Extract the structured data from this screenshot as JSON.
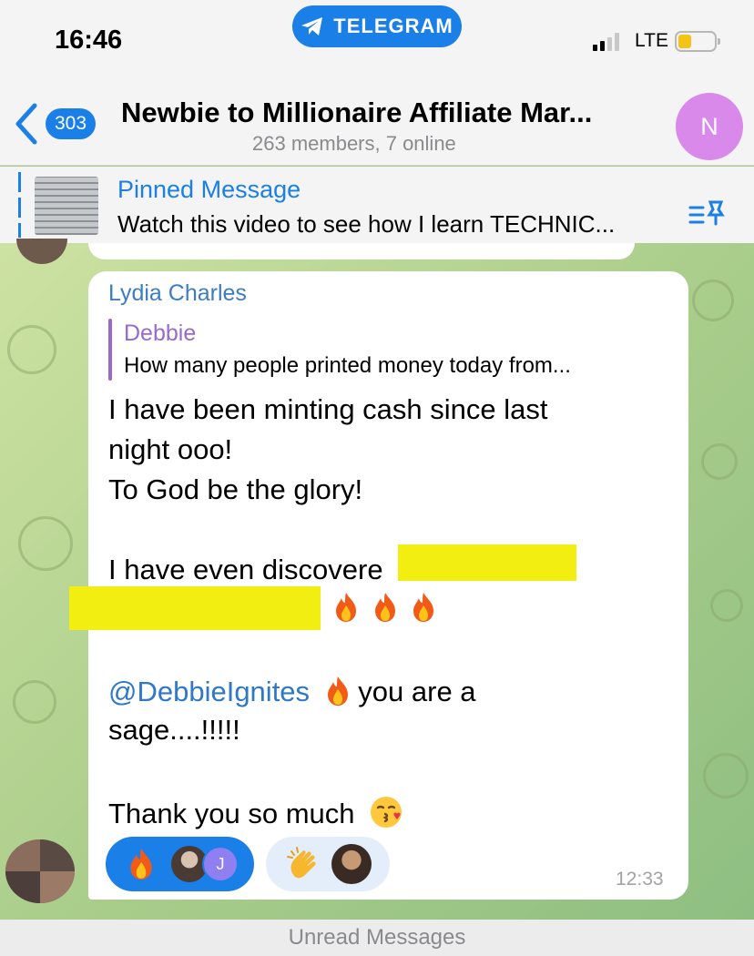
{
  "status_bar": {
    "time": "16:46",
    "app_pill": "TELEGRAM",
    "network": "LTE",
    "battery_level": 0.25
  },
  "header": {
    "back_count": "303",
    "title": "Newbie to Millionaire Affiliate Mar...",
    "subtitle": "263 members, 7 online",
    "avatar_letter": "N",
    "avatar_color": "#d889ea"
  },
  "pinned": {
    "title": "Pinned Message",
    "text": "Watch this video to see how I learn TECHNIC..."
  },
  "message": {
    "sender": "Lydia Charles",
    "reply": {
      "name": "Debbie",
      "text": "How many people printed money today from..."
    },
    "lines": {
      "l1": "I have been minting cash since last",
      "l2": "night ooo!",
      "l3": "To God be the glory!",
      "l4": "I have even discovere",
      "mention": "@DebbieIgnites",
      "l6_rest": "you are a",
      "l7": "sage....!!!!!",
      "l8": "Thank you so much"
    },
    "time": "12:33",
    "reactions": [
      {
        "emoji": "fire",
        "avatar_letter": "J",
        "selected": true
      },
      {
        "emoji": "clapping-hands",
        "selected": false
      }
    ]
  },
  "footer": {
    "unread": "Unread Messages"
  },
  "colors": {
    "accent": "#1b7fe8",
    "sender": "#3a7dc4",
    "reply": "#9b6ac9",
    "highlight": "#f2ee12"
  }
}
